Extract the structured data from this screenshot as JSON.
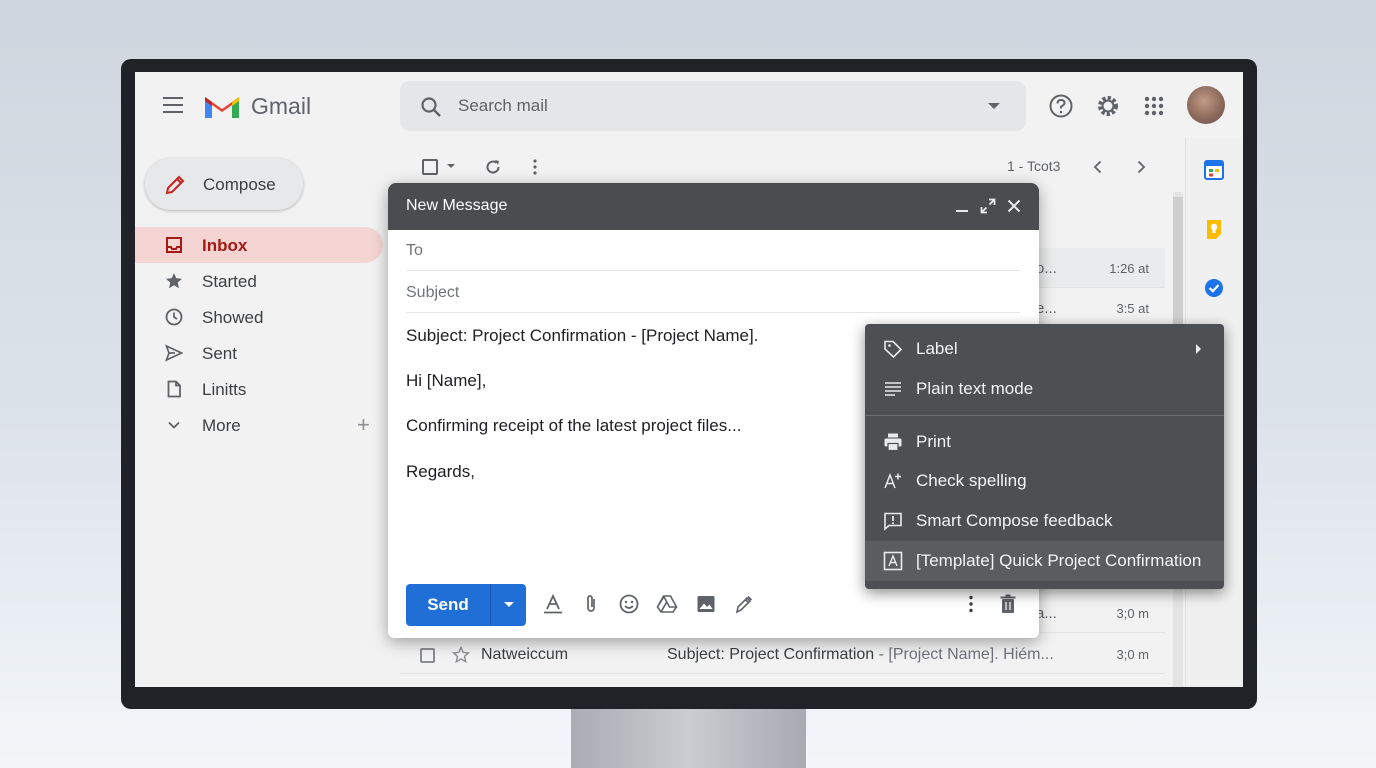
{
  "app": {
    "brand": "Gmail",
    "search_placeholder": "Search mail",
    "pager": "1 - Tcot3"
  },
  "compose_button": {
    "label": "Compose"
  },
  "nav": {
    "items": [
      {
        "label": "Inbox",
        "icon": "inbox-icon",
        "active": true
      },
      {
        "label": "Started",
        "icon": "star-icon"
      },
      {
        "label": "Showed",
        "icon": "clock-icon"
      },
      {
        "label": "Sent",
        "icon": "send-icon"
      },
      {
        "label": "Linitts",
        "icon": "file-icon"
      },
      {
        "label": "More",
        "icon": "chevron-down-icon"
      }
    ]
  },
  "mail_list": {
    "rows": [
      {
        "snippet": "o...",
        "time": "1:26 at"
      },
      {
        "snippet": "e...",
        "time": "3:5 at"
      },
      {
        "snippet": "a...",
        "time": "3;0 m"
      },
      {
        "sender": "Natweiccum",
        "subject": "Subject: Project Confirmation",
        "snippet": "- [Project Name]. Hiém...",
        "time": "3;0 m"
      }
    ]
  },
  "compose_window": {
    "title": "New Message",
    "to_placeholder": "To",
    "subject_placeholder": "Subject",
    "body": [
      "Subject: Project Confirmation - [Project Name].",
      "Hi [Name],",
      "Confirming receipt of the latest project files...",
      "Regards,"
    ],
    "send_label": "Send"
  },
  "context_menu": {
    "items": [
      {
        "label": "Label",
        "icon": "label-icon",
        "submenu": true
      },
      {
        "label": "Plain text mode",
        "icon": "plain-text-icon"
      },
      {
        "label": "Print",
        "icon": "print-icon"
      },
      {
        "label": "Check spelling",
        "icon": "spellcheck-icon"
      },
      {
        "label": "Smart Compose feedback",
        "icon": "feedback-icon"
      },
      {
        "label": "[Template] Quick Project Confirmation",
        "icon": "template-icon",
        "highlighted": true
      }
    ]
  },
  "colors": {
    "accent_blue": "#1f6fd6",
    "inbox_red": "#a31b12",
    "menu_bg": "#4d4f52"
  }
}
